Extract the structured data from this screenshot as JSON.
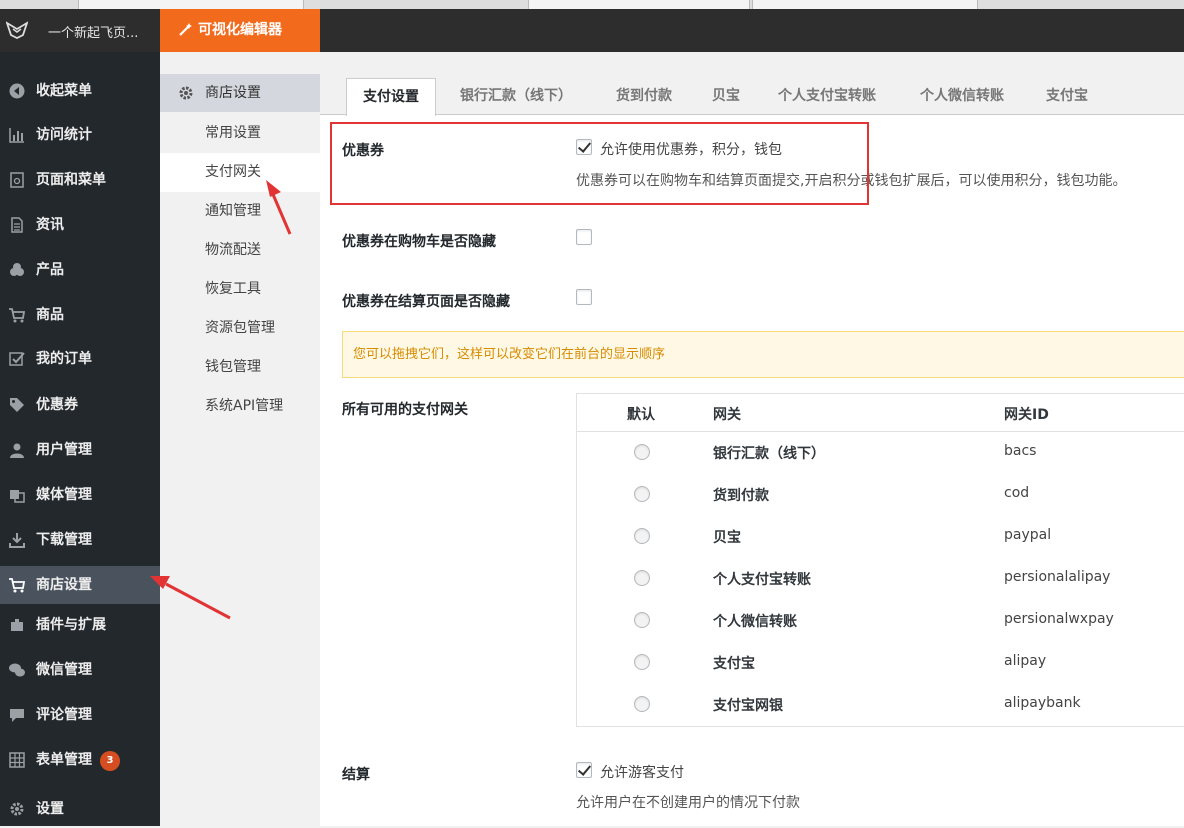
{
  "admin_bar": {
    "site_name": "一个新起飞页...",
    "visual_editor_label": "可视化编辑器"
  },
  "sidebar": {
    "items": [
      {
        "label": "收起菜单",
        "icon": "collapse-icon"
      },
      {
        "label": "访问统计",
        "icon": "bar-chart-icon"
      },
      {
        "label": "页面和菜单",
        "icon": "page-icon"
      },
      {
        "label": "资讯",
        "icon": "document-icon"
      },
      {
        "label": "产品",
        "icon": "products-icon"
      },
      {
        "label": "商品",
        "icon": "cart-icon"
      },
      {
        "label": "我的订单",
        "icon": "checklist-icon"
      },
      {
        "label": "优惠券",
        "icon": "tag-icon"
      },
      {
        "label": "用户管理",
        "icon": "user-icon"
      },
      {
        "label": "媒体管理",
        "icon": "media-icon"
      },
      {
        "label": "下载管理",
        "icon": "download-icon"
      },
      {
        "label": "商店设置",
        "icon": "cart-icon"
      },
      {
        "label": "插件与扩展",
        "icon": "plugin-icon"
      },
      {
        "label": "微信管理",
        "icon": "wechat-icon"
      },
      {
        "label": "评论管理",
        "icon": "comment-icon"
      },
      {
        "label": "表单管理",
        "icon": "table-icon",
        "badge": "3"
      },
      {
        "label": "设置",
        "icon": "gear-icon"
      }
    ],
    "active": "商店设置"
  },
  "subnav": {
    "heading": "商店设置",
    "items": [
      "常用设置",
      "支付网关",
      "通知管理",
      "物流配送",
      "恢复工具",
      "资源包管理",
      "钱包管理",
      "系统API管理"
    ],
    "active": "支付网关"
  },
  "tabs": [
    "支付设置",
    "银行汇款（线下）",
    "货到付款",
    "贝宝",
    "个人支付宝转账",
    "个人微信转账",
    "支付宝"
  ],
  "active_tab": "支付设置",
  "coupon": {
    "label": "优惠券",
    "checkbox_label": "允许使用优惠券，积分，钱包",
    "checked": true,
    "description": "优惠券可以在购物车和结算页面提交,开启积分或钱包扩展后，可以使用积分，钱包功能。"
  },
  "hide_in_cart": {
    "label": "优惠券在购物车是否隐藏",
    "checked": false
  },
  "hide_in_checkout": {
    "label": "优惠券在结算页面是否隐藏",
    "checked": false
  },
  "notice": "您可以拖拽它们，这样可以改变它们在前台的显示顺序",
  "gateways": {
    "label": "所有可用的支付网关",
    "headers": {
      "default": "默认",
      "gateway": "网关",
      "id": "网关ID"
    },
    "rows": [
      {
        "name": "银行汇款（线下）",
        "id": "bacs"
      },
      {
        "name": "货到付款",
        "id": "cod"
      },
      {
        "name": "贝宝",
        "id": "paypal"
      },
      {
        "name": "个人支付宝转账",
        "id": "persionalalipay"
      },
      {
        "name": "个人微信转账",
        "id": "persionalwxpay"
      },
      {
        "name": "支付宝",
        "id": "alipay"
      },
      {
        "name": "支付宝网银",
        "id": "alipaybank"
      }
    ]
  },
  "checkout": {
    "label": "结算",
    "checkbox_label": "允许游客支付",
    "checked": true,
    "description": "允许用户在不创建用户的情况下付款"
  },
  "colors": {
    "accent": "#f26b1d",
    "sidebar_bg": "#23282d",
    "annotation_red": "#e23434"
  }
}
